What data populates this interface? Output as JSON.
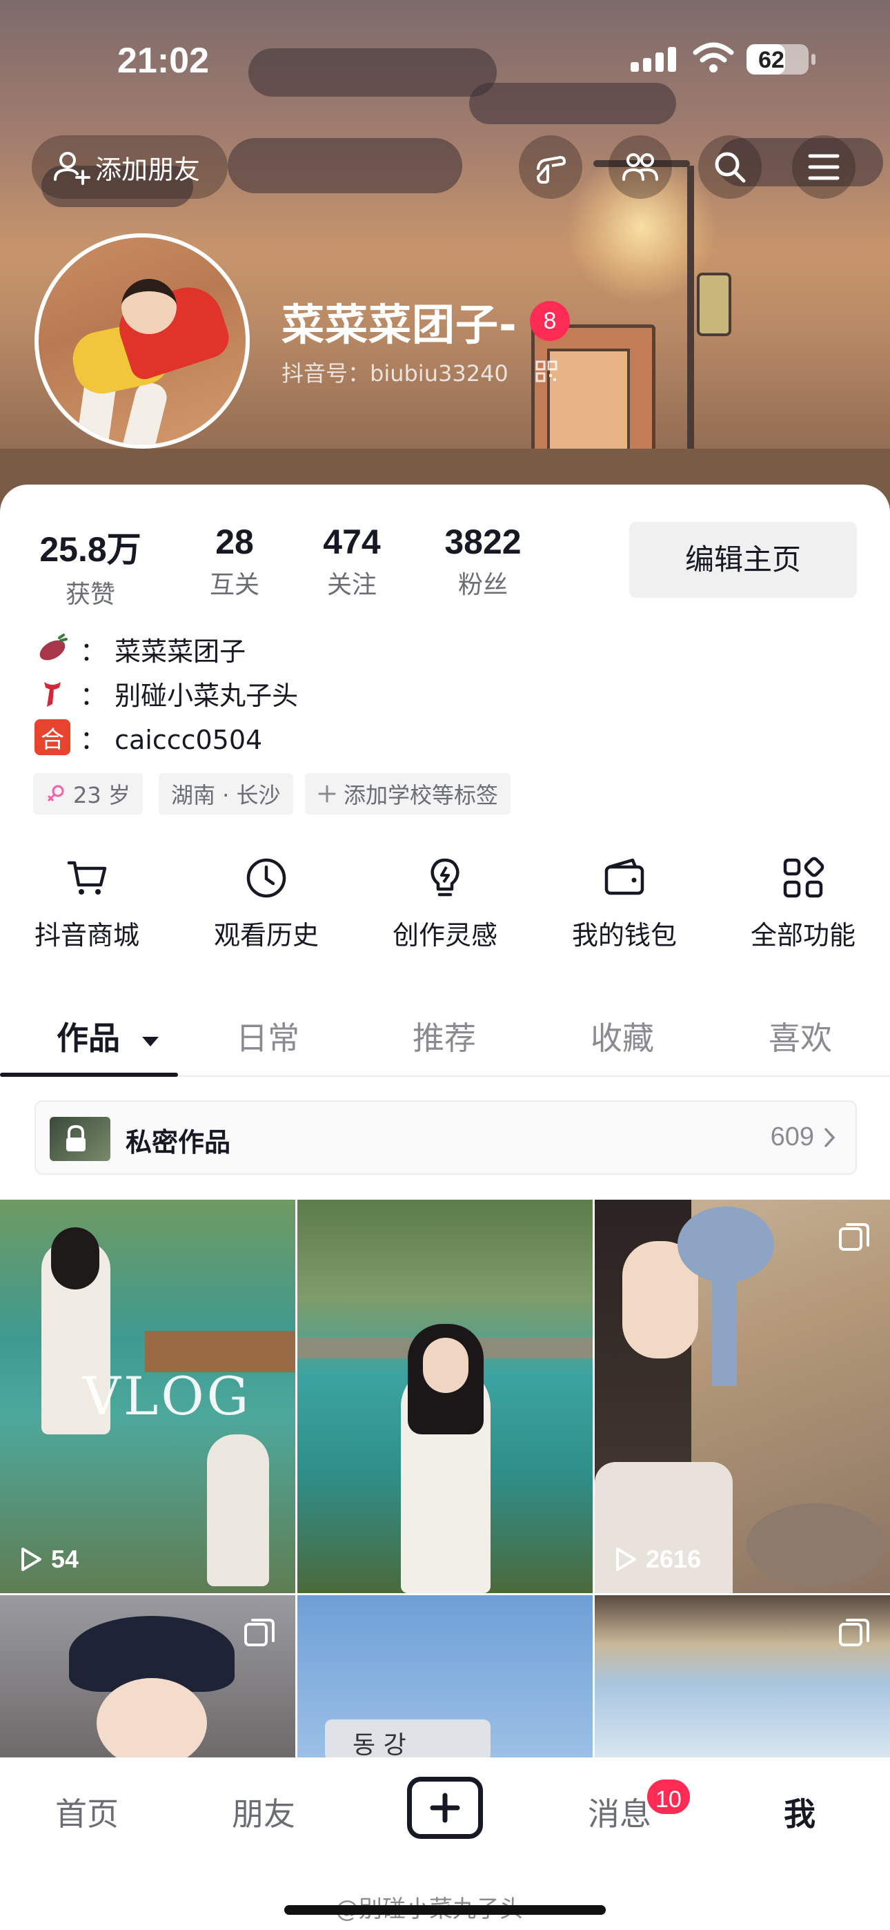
{
  "status_bar": {
    "time": "21:02",
    "battery": "62",
    "battery_level_percent": 62
  },
  "header": {
    "add_friend_label": "添加朋友",
    "username": "菜菜菜团子-",
    "name_badge": "8",
    "douyin_id": "抖音号：biubiu33240"
  },
  "stats": [
    {
      "value": "25.8万",
      "label": "获赞"
    },
    {
      "value": "28",
      "label": "互关"
    },
    {
      "value": "474",
      "label": "关注"
    },
    {
      "value": "3822",
      "label": "粉丝"
    }
  ],
  "edit_profile_label": "编辑主页",
  "bio": [
    {
      "icon": "sweet-potato-icon",
      "text": "：  菜菜菜团子"
    },
    {
      "icon": "scarf-icon",
      "text": "：  别碰小菜丸子头"
    },
    {
      "icon": "he-character-icon",
      "icon_text": "合",
      "text": "：  caiccc0504"
    }
  ],
  "tags": [
    "23 岁",
    "湖南 · 长沙",
    "添加学校等标签"
  ],
  "functions": [
    {
      "icon": "cart-icon",
      "label": "抖音商城"
    },
    {
      "icon": "clock-icon",
      "label": "观看历史"
    },
    {
      "icon": "lightbulb-icon",
      "label": "创作灵感"
    },
    {
      "icon": "wallet-icon",
      "label": "我的钱包"
    },
    {
      "icon": "grid-icon",
      "label": "全部功能"
    }
  ],
  "tabs": [
    "作品",
    "日常",
    "推荐",
    "收藏",
    "喜欢"
  ],
  "private_works": {
    "label": "私密作品",
    "count": "609"
  },
  "videos": [
    {
      "views": "54",
      "overlay_text": "VLOG"
    },
    {
      "views": ""
    },
    {
      "views": "2616"
    },
    {
      "views": ""
    },
    {
      "views": "",
      "sign_text": "동  강"
    },
    {
      "views": ""
    }
  ],
  "bottom_nav": {
    "home": "首页",
    "friends": "朋友",
    "messages": "消息",
    "messages_badge": "10",
    "me": "我"
  },
  "watermark": "@别碰小菜丸子头",
  "colors": {
    "accent": "#fe2c55",
    "text": "#161823",
    "secondary": "#6b6d75"
  }
}
